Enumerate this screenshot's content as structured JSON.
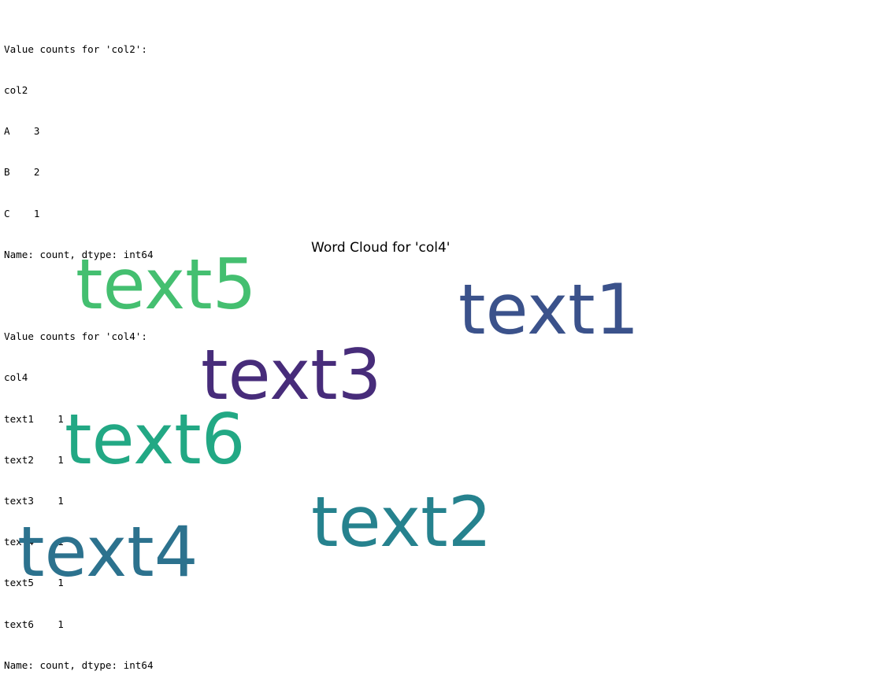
{
  "output": {
    "lines": [
      "Value counts for 'col2':",
      "col2",
      "A    3",
      "B    2",
      "C    1",
      "Name: count, dtype: int64",
      "",
      "Value counts for 'col4':",
      "col4",
      "text1    1",
      "text2    1",
      "text3    1",
      "text4    1",
      "text5    1",
      "text6    1",
      "Name: count, dtype: int64"
    ]
  },
  "figure": {
    "title": "Word Cloud for 'col4'",
    "words": [
      {
        "text": "text5",
        "color": "#44bf70"
      },
      {
        "text": "text1",
        "color": "#3b528b"
      },
      {
        "text": "text3",
        "color": "#472c7a"
      },
      {
        "text": "text6",
        "color": "#22a884"
      },
      {
        "text": "text2",
        "color": "#26828e"
      },
      {
        "text": "text4",
        "color": "#2c728e"
      }
    ]
  }
}
